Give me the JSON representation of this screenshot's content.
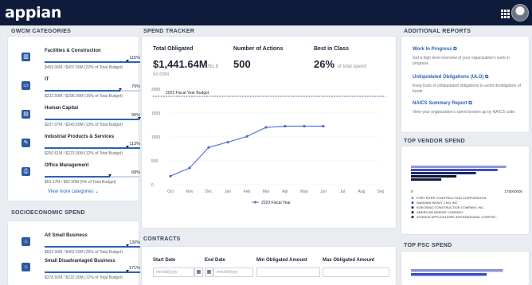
{
  "app": {
    "logo": "appian"
  },
  "gwcm": {
    "title": "GWCM CATEGORIES",
    "items": [
      {
        "icon": "building-icon",
        "glyph": "▥",
        "name": "Facilities & Construction",
        "pct": "115%",
        "fill": 1.0,
        "sub": "$469.06M / $407.00M (22% of Total Budget)"
      },
      {
        "icon": "laptop-icon",
        "glyph": "▭",
        "name": "IT",
        "pct": "79%",
        "fill": 0.79,
        "sub": "$232.59M / $296.00M (16% of Total Budget)"
      },
      {
        "icon": "id-card-icon",
        "glyph": "▤",
        "name": "Human Capital",
        "pct": "99%",
        "fill": 0.99,
        "sub": "$237.07M / $240.50M (13% of Total Budget)"
      },
      {
        "icon": "wrench-icon",
        "glyph": "✎",
        "name": "Industrial Products & Services",
        "pct": "113%",
        "fill": 1.0,
        "sub": "$250.61M / $222.00M (12% of Total Budget)"
      },
      {
        "icon": "printer-icon",
        "glyph": "⎙",
        "name": "Office Management",
        "pct": "68%",
        "fill": 0.68,
        "sub": "$63.17M / $92.50M (5% of Total Budget)"
      }
    ],
    "more_link": "View more categories ⌄"
  },
  "socio": {
    "title": "SOCIOECONOMIC SPEND",
    "items": [
      {
        "icon": "handshake-icon",
        "glyph": "⌂",
        "name": "All Small Business",
        "pct": "130%",
        "fill": 1.0,
        "sub": "$602.90M / $462.50M (25% of Total Budget)"
      },
      {
        "icon": "handshake-icon",
        "glyph": "⌂",
        "name": "Small Disadvantaged Business",
        "pct": "171%",
        "fill": 1.0,
        "sub": "$378.92M / $222.00M (12% of Total Budget)"
      }
    ]
  },
  "tracker": {
    "title": "SPEND TRACKER",
    "total_obligated_label": "Total Obligated",
    "total_obligated_value": "$1,441.64M",
    "total_obligated_of": "/$1.8",
    "total_obligated_cont": "50.00M",
    "actions_label": "Number of Actions",
    "actions_value": "500",
    "best_label": "Best in Class",
    "best_value": "26%",
    "best_suffix": "of total spend"
  },
  "chart_data": {
    "type": "line",
    "categories": [
      "Oct",
      "Nov",
      "Dec",
      "Jan",
      "Feb",
      "Mar",
      "Apr",
      "May",
      "Jun",
      "Jul",
      "Aug",
      "Sep"
    ],
    "series": [
      {
        "name": "2023 Fiscal Year",
        "values": [
          180,
          350,
          780,
          890,
          1010,
          1200,
          1225,
          1225,
          1225,
          null,
          null,
          null
        ]
      }
    ],
    "budget_line": {
      "label": "2023 Fiscal Year Budget",
      "value": 1850
    },
    "yticks": [
      0,
      500,
      1000,
      1500,
      2000
    ],
    "ytick_labels": [
      "0",
      "500",
      "1000",
      "1500",
      "2000"
    ],
    "ylim": [
      0,
      2000
    ],
    "legend_position": "bottom"
  },
  "contracts": {
    "title": "CONTRACTS",
    "start_label": "Start Date",
    "end_label": "End Date",
    "min_label": "Min Obligated Amount",
    "max_label": "Max Obligated Amount",
    "start_placeholder": "mm/dd/yyyy",
    "end_placeholder": "mm/dd/yyyy"
  },
  "reports": {
    "title": "ADDITIONAL REPORTS",
    "items": [
      {
        "name": "Work In Progress",
        "desc": "Get a high level overview of your organization's work in progress."
      },
      {
        "name": "Unliquidated Obligations (ULO)",
        "desc": "Keep track of unliquidated obligations to avoid deobligation of funds."
      },
      {
        "name": "NAICS Summary Report",
        "desc": "View your organization's spend broken up by NAICS code."
      }
    ]
  },
  "vendor": {
    "title": "TOP VENDOR SPEND",
    "axis_min": "0",
    "axis_max": "175000000",
    "bars": [
      {
        "value": 0.88,
        "color": "#8f95d6"
      },
      {
        "value": 0.8,
        "color": "#3a4fc9"
      },
      {
        "value": 0.6,
        "color": "#1b2a6b"
      },
      {
        "value": 0.42,
        "color": "#0d1430"
      },
      {
        "value": 0.28,
        "color": "#0f1b3a"
      }
    ],
    "legend": [
      {
        "label": "FORT MYER CONSTRUCTION CORPORATION",
        "color": "#8f95d6"
      },
      {
        "label": "WAGMAN HEAVY CIVIL INC",
        "color": "#3a4fc9"
      },
      {
        "label": "KOKOSING CONSTRUCTION COMPANY, INC.",
        "color": "#1b2a6b"
      },
      {
        "label": "AMERICAN BRIDGE COMPANY",
        "color": "#0d1430"
      },
      {
        "label": "SCIENCE APPLICATIONS INTERNATIONAL CORPOR...",
        "color": "#0f1b3a"
      }
    ]
  },
  "psc": {
    "title": "TOP PSC SPEND",
    "bars": [
      {
        "value": 0.85,
        "color": "#8f95d6"
      },
      {
        "value": 0.7,
        "color": "#3a4fc9"
      }
    ]
  }
}
